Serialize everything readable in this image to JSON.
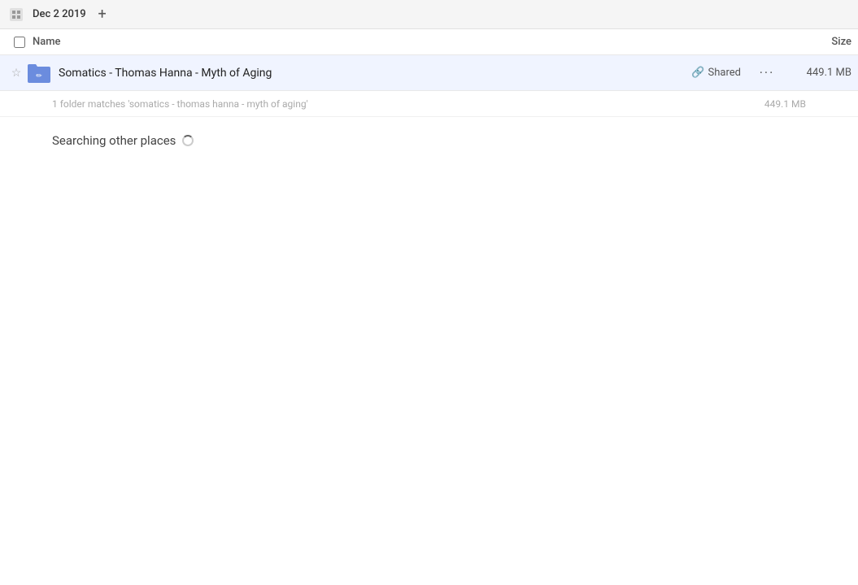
{
  "topbar": {
    "home_icon": "🏠",
    "date": "Dec 2 2019",
    "add_icon": "+"
  },
  "columns": {
    "name_label": "Name",
    "size_label": "Size"
  },
  "file_row": {
    "name": "Somatics - Thomas Hanna - Myth of Aging",
    "shared_label": "Shared",
    "size": "449.1 MB",
    "actions": "···"
  },
  "summary": {
    "text": "1 folder matches 'somatics - thomas hanna - myth of aging'",
    "size": "449.1 MB"
  },
  "searching": {
    "label": "Searching other places"
  }
}
